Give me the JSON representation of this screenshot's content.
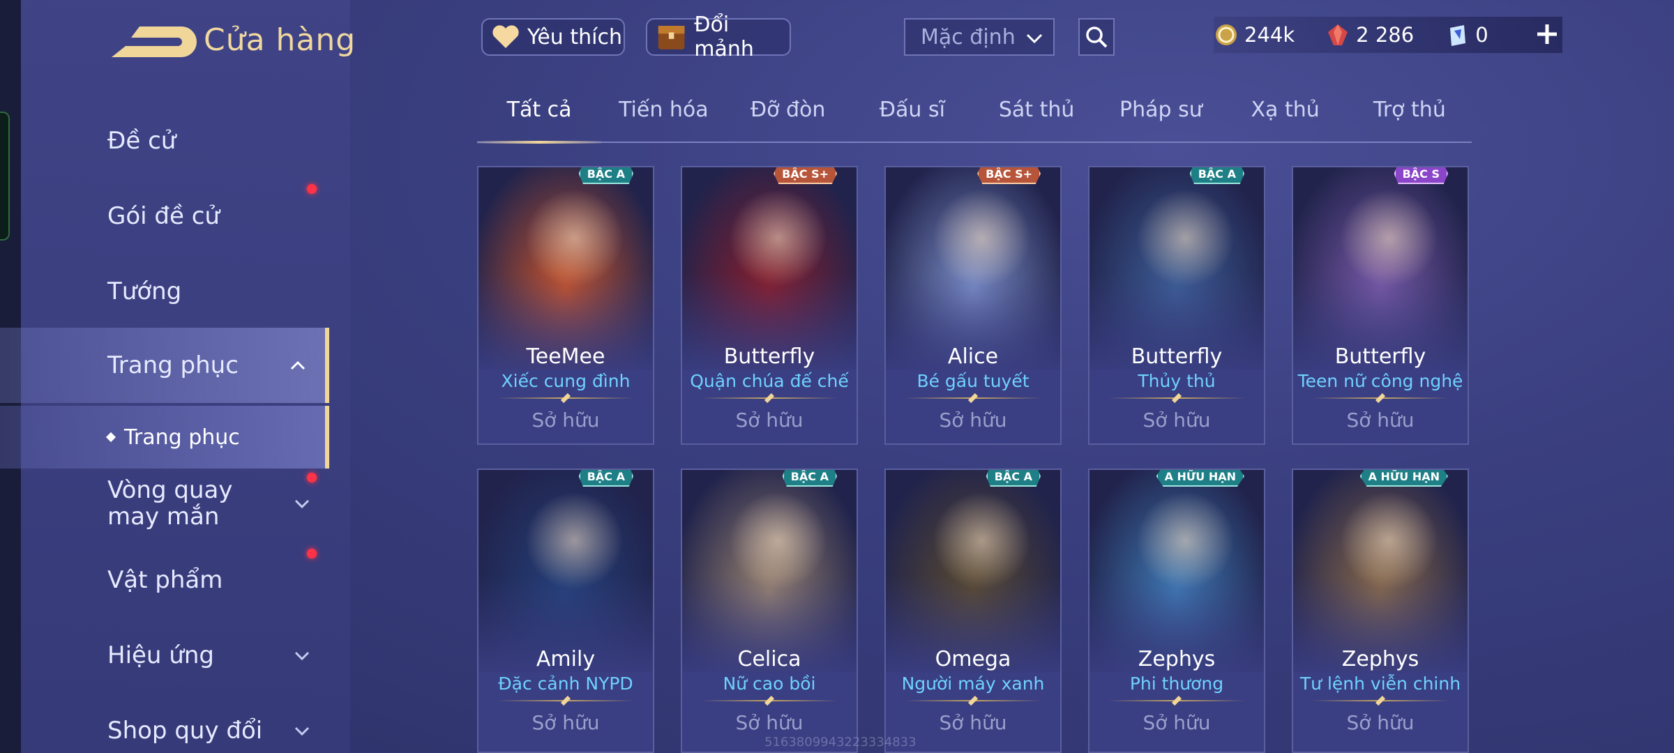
{
  "header": {
    "title": "Cửa hàng"
  },
  "toolbar": {
    "favorite_label": "Yêu thích",
    "exchange_label": "Đổi mảnh",
    "sort_value": "Mặc định"
  },
  "currency": {
    "gold": "244k",
    "gems": "2 286",
    "vouchers": "0"
  },
  "sidebar": {
    "items": [
      {
        "label": "Đề cử"
      },
      {
        "label": "Gói đề cử"
      },
      {
        "label": "Tướng"
      },
      {
        "label": "Trang phục"
      },
      {
        "label": "Vòng quay may mắn"
      },
      {
        "label": "Vật phẩm"
      },
      {
        "label": "Hiệu ứng"
      },
      {
        "label": "Shop quy đổi"
      }
    ],
    "sub_item": "Trang phục"
  },
  "tabs": [
    "Tất cả",
    "Tiến hóa",
    "Đỡ đòn",
    "Đấu sĩ",
    "Sát thủ",
    "Pháp sư",
    "Xạ thủ",
    "Trợ thủ"
  ],
  "cards": [
    {
      "tier": "BẬC A",
      "hero": "TeeMee",
      "skin": "Xiếc cung đình",
      "status": "Sở hữu",
      "palette": "#c9542a"
    },
    {
      "tier": "BẬC S+",
      "hero": "Butterfly",
      "skin": "Quận chúa đế chế",
      "status": "Sở hữu",
      "palette": "#8a1d2a"
    },
    {
      "tier": "BẬC S+",
      "hero": "Alice",
      "skin": "Bé gấu tuyết",
      "status": "Sở hữu",
      "palette": "#7c8fc8"
    },
    {
      "tier": "BẬC A",
      "hero": "Butterfly",
      "skin": "Thủy thủ",
      "status": "Sở hữu",
      "palette": "#3d5f98"
    },
    {
      "tier": "BẬC S",
      "hero": "Butterfly",
      "skin": "Teen nữ công nghệ",
      "status": "Sở hữu",
      "palette": "#7a5aa8"
    },
    {
      "tier": "BẬC A",
      "hero": "Amily",
      "skin": "Đặc cảnh NYPD",
      "status": "Sở hữu",
      "palette": "#24407a"
    },
    {
      "tier": "BẬC A",
      "hero": "Celica",
      "skin": "Nữ cao bồi",
      "status": "Sở hữu",
      "palette": "#9a8470"
    },
    {
      "tier": "BẬC A",
      "hero": "Omega",
      "skin": "Người máy xanh",
      "status": "Sở hữu",
      "palette": "#5a4a2e"
    },
    {
      "tier": "A HỮU HẠN",
      "hero": "Zephys",
      "skin": "Phi thương",
      "status": "Sở hữu",
      "palette": "#3f7bb6"
    },
    {
      "tier": "A HỮU HẠN",
      "hero": "Zephys",
      "skin": "Tư lệnh viễn chinh",
      "status": "Sở hữu",
      "palette": "#8a6a48"
    }
  ],
  "watermark": "5163809943223334833"
}
